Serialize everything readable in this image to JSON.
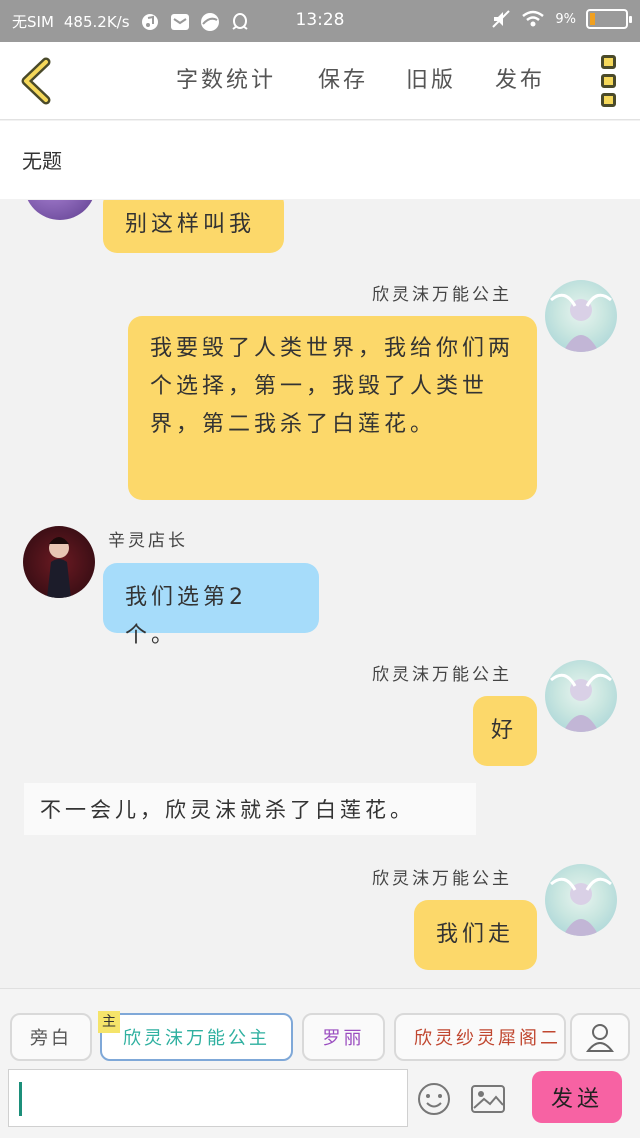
{
  "status": {
    "sim": "无SIM",
    "speed": "485.2K/s",
    "time": "13:28",
    "battery": "9%",
    "battery_level": 0.09
  },
  "toolbar": {
    "word_count": "字数统计",
    "save": "保存",
    "old_version": "旧版",
    "publish": "发布"
  },
  "document": {
    "title": "无题"
  },
  "messages": [
    {
      "speaker": "",
      "text": "别这样叫我",
      "side": "left",
      "color": "yellow"
    },
    {
      "speaker": "欣灵沫万能公主",
      "text": "我要毁了人类世界，我给你们两个选择，第一，我毁了人类世界，第二我杀了白莲花。",
      "side": "right",
      "color": "yellow"
    },
    {
      "speaker": "辛灵店长",
      "text": "我们选第2个。",
      "side": "left",
      "color": "blue"
    },
    {
      "speaker": "欣灵沫万能公主",
      "text": "好",
      "side": "right",
      "color": "yellow"
    },
    {
      "speaker": "",
      "text": "不一会儿，欣灵沫就杀了白莲花。",
      "side": "narration",
      "color": "white"
    },
    {
      "speaker": "欣灵沫万能公主",
      "text": "我们走",
      "side": "right",
      "color": "yellow"
    }
  ],
  "characters": {
    "narrator": "旁白",
    "main_badge": "主",
    "main": "欣灵沫万能公主",
    "second": "罗丽",
    "third": "欣灵纱灵犀阁二"
  },
  "composer": {
    "input_value": "",
    "send": "发送"
  },
  "colors": {
    "yellow_bubble": "#fcd86a",
    "blue_bubble": "#a6dcfa",
    "send_button": "#f762a3"
  }
}
